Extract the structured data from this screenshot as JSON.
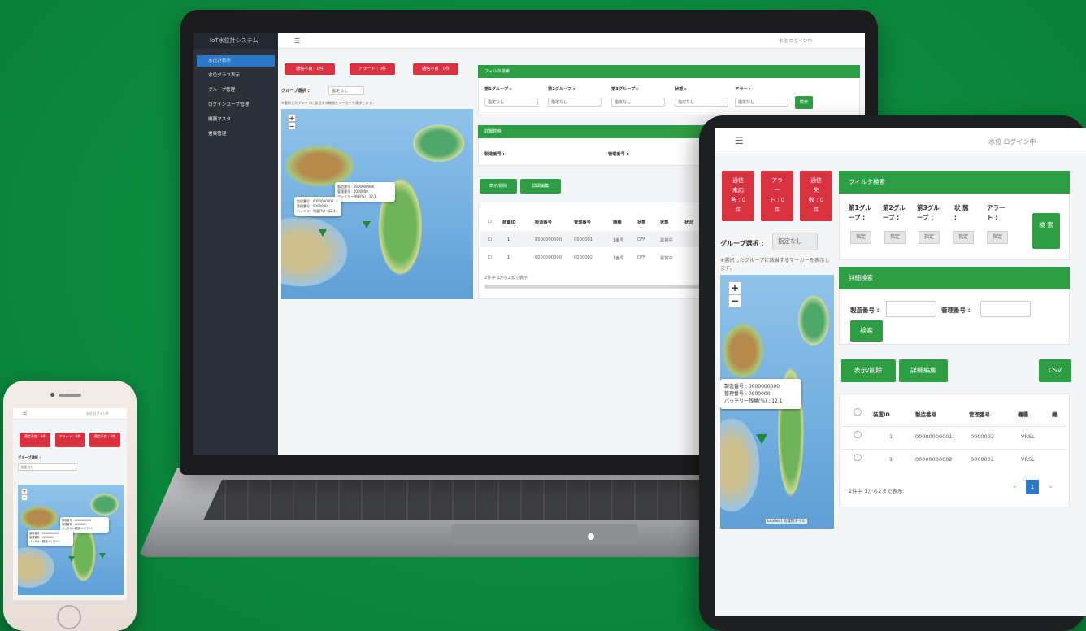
{
  "laptop": {
    "brand": "IoT水位計システム",
    "nav": [
      "水位計表示",
      "水位グラフ表示",
      "グループ管理",
      "ログインユーザ管理",
      "機器マスタ",
      "営業管理"
    ],
    "topbar_user": "水位 ログイン中",
    "status_buttons": [
      "通信不良 : 0件",
      "アラート : 0件",
      "通信不良 : 0件"
    ],
    "group_select": {
      "label": "グループ選択 :",
      "value": "指定なし"
    },
    "map_note": "※選択したグループに該当する機器をマーカーで表示します。",
    "filter": {
      "title": "フィルタ検索",
      "fields": [
        {
          "label": "第1グループ :",
          "value": "指定なし"
        },
        {
          "label": "第2グループ :",
          "value": "指定なし"
        },
        {
          "label": "第3グループ :",
          "value": "指定なし"
        },
        {
          "label": "状態 :",
          "value": "指定なし"
        },
        {
          "label": "アラート :",
          "value": "指定なし"
        }
      ],
      "search": "検索"
    },
    "detail_search": {
      "title": "詳細検索",
      "fields": [
        "製造番号 :",
        "管理番号 :"
      ]
    },
    "actions": {
      "show_delete": "表示/削除",
      "detail_edit": "詳細編集"
    },
    "table": {
      "headers": [
        "装置ID",
        "製造番号",
        "管理番号",
        "機種",
        "状態",
        "状態",
        "状況"
      ],
      "rows": [
        [
          "1",
          "0000000000",
          "0000001",
          "1番号",
          "OFF",
          "異常中"
        ],
        [
          "1",
          "0000000000",
          "0000002",
          "1番号",
          "OFF",
          "異常中"
        ]
      ],
      "footer": "2件中 1から2まで表示"
    },
    "popup": [
      "製造番号 : 0000000000",
      "管理番号 : 0000000",
      "バッテリー残量(%) : 12.1"
    ]
  },
  "tablet": {
    "topbar_user": "水位 ログイン中",
    "status_buttons": [
      [
        "通信",
        "未応",
        "答 : 0",
        "件"
      ],
      [
        "アラ",
        "ー",
        "ト : 0",
        "件"
      ],
      [
        "通信",
        "失",
        "敗 : 0",
        "件"
      ]
    ],
    "group_select": {
      "label": "グループ選択 :",
      "value": "指定なし"
    },
    "map_note": "※選択したグループに該当するマーカーを表示します。",
    "filter": {
      "title": "フィルタ検索",
      "fields": [
        {
          "label": "第1グル ープ :",
          "value": "指定"
        },
        {
          "label": "第2グル ープ :",
          "value": "指定"
        },
        {
          "label": "第3グル ープ :",
          "value": "指定"
        },
        {
          "label": "状 態 :",
          "value": "指定"
        },
        {
          "label": "アラー ト :",
          "value": "指定"
        }
      ],
      "search": "検 索"
    },
    "detail_search": {
      "title": "詳細検索",
      "manufacture": "製造番号 :",
      "management": "管理番号 :",
      "search": "検索"
    },
    "actions": {
      "show_delete": "表示/削除",
      "detail_edit": "詳細編集",
      "csv": "CSV"
    },
    "table": {
      "headers": [
        "装置ID",
        "製造番号",
        "管理番号",
        "機種",
        "機"
      ],
      "rows": [
        [
          "1",
          "00000000001",
          "0000002",
          "VRSL"
        ],
        [
          "1",
          "00000000002",
          "0000002",
          "VRSL"
        ]
      ],
      "footer": "2件中 1から2まで表示",
      "page": "1"
    },
    "popup": [
      "製造番号 : 0000000000",
      "管理番号 : 0000000",
      "バッテリー残量(%) : 12.1"
    ],
    "attribution": "Leaflet | 地理院タイル"
  },
  "phone": {
    "topbar_user": "水位 ログイン中",
    "status_buttons": [
      "通信不良 : 0件",
      "アラート : 0件",
      "通信不良 : 0件"
    ],
    "group_select": {
      "label": "グループ選択 :",
      "value": "指定なし"
    },
    "popup": [
      "製造番号 : 0000000000",
      "管理番号 : 0000000",
      "バッテリー残量(%) : 12.1"
    ]
  },
  "colors": {
    "background": "#0b8a3e",
    "accent_green": "#2e9e44",
    "alert_red": "#d8313f",
    "sidebar": "#2b3138",
    "active_nav": "#2a79c9"
  }
}
